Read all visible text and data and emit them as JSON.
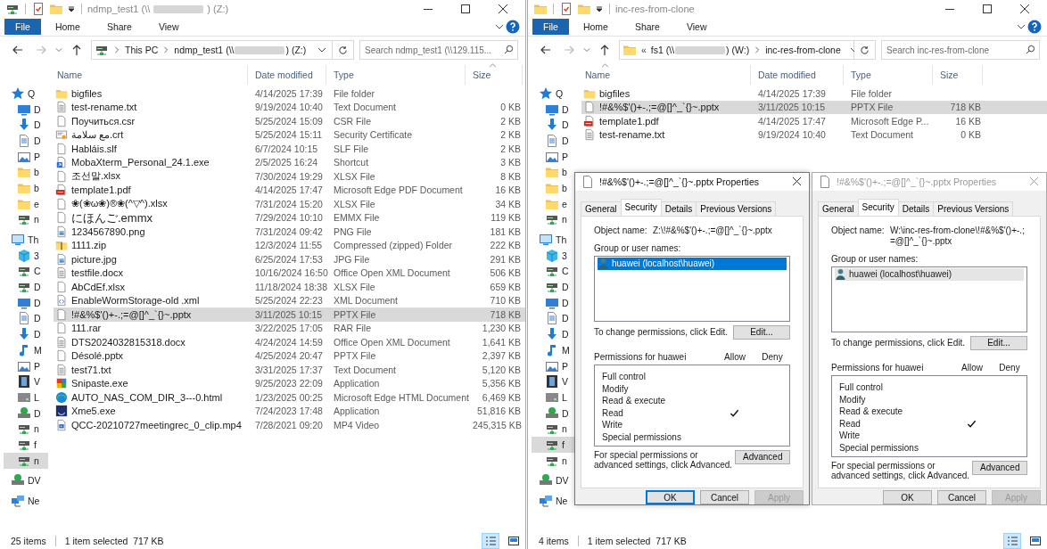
{
  "windows": [
    {
      "title": [
        "ndmp_test1 (\\\\",
        ") (Z:)"
      ],
      "ribbon_tabs": [
        {
          "label": "File",
          "kind": "file"
        },
        {
          "label": "Home",
          "kind": "tab"
        },
        {
          "label": "Share",
          "kind": "tab"
        },
        {
          "label": "View",
          "kind": "tab"
        }
      ],
      "address": {
        "crumbs": [
          [
            "This PC"
          ],
          [
            "ndmp_test1 (\\\\",
            ") (Z:)"
          ]
        ]
      },
      "search_placeholder": "Search ndmp_test1 (\\\\129.115...",
      "columns": [
        {
          "label": "Name",
          "sorted": false
        },
        {
          "label": "Date modified",
          "sorted": false
        },
        {
          "label": "Type",
          "sorted": false
        },
        {
          "label": "Size",
          "sorted": true
        }
      ],
      "nav": [
        {
          "kind": "quick-access",
          "label": "Q",
          "selected": false
        },
        {
          "kind": "desktop",
          "label": "D",
          "selected": false
        },
        {
          "kind": "download",
          "label": "D",
          "selected": false
        },
        {
          "kind": "doc",
          "label": "D",
          "selected": false
        },
        {
          "kind": "picture",
          "label": "P",
          "selected": false
        },
        {
          "kind": "folder",
          "label": "b",
          "selected": false
        },
        {
          "kind": "folder",
          "label": "b",
          "selected": false
        },
        {
          "kind": "folder",
          "label": "e",
          "selected": false
        },
        {
          "kind": "netdrive",
          "label": "n",
          "selected": false
        },
        {
          "kind": "this-pc",
          "label": "Th",
          "selected": false
        },
        {
          "kind": "cube",
          "label": "3",
          "selected": false
        },
        {
          "kind": "netdrive",
          "label": "C",
          "selected": false
        },
        {
          "kind": "netdrive",
          "label": "D",
          "selected": false
        },
        {
          "kind": "desktop",
          "label": "D",
          "selected": false
        },
        {
          "kind": "doc",
          "label": "D",
          "selected": false
        },
        {
          "kind": "download",
          "label": "D",
          "selected": false
        },
        {
          "kind": "music",
          "label": "M",
          "selected": false
        },
        {
          "kind": "picture",
          "label": "P",
          "selected": false
        },
        {
          "kind": "film",
          "label": "V",
          "selected": false
        },
        {
          "kind": "disk",
          "label": "L",
          "selected": false
        },
        {
          "kind": "dvd",
          "label": "D",
          "selected": false
        },
        {
          "kind": "netdrive",
          "label": "n",
          "selected": false
        },
        {
          "kind": "netdrive",
          "label": "f",
          "selected": false
        },
        {
          "kind": "netdrive",
          "label": "n",
          "selected": true
        },
        {
          "kind": "dvd-root",
          "label": "DV",
          "selected": false
        },
        {
          "kind": "network",
          "label": "Ne",
          "selected": false
        }
      ],
      "files": [
        {
          "kind": "folder",
          "name": "bigfiles",
          "date": "4/14/2025 17:39",
          "type": "File folder",
          "selected": false
        },
        {
          "kind": "text",
          "name": "test-rename.txt",
          "date": "9/19/2024 10:40",
          "type": "Text Document",
          "size": "0 KB",
          "selected": false
        },
        {
          "kind": "blank",
          "name": "Поучиться.csr",
          "date": "5/25/2024 15:09",
          "type": "CSR File",
          "size": "2 KB",
          "selected": false
        },
        {
          "kind": "cert",
          "name": "مع سلامة.crt",
          "date": "5/25/2024 15:11",
          "type": "Security Certificate",
          "size": "2 KB",
          "selected": false
        },
        {
          "kind": "blank",
          "name": "Habláis.slf",
          "date": "6/7/2024 10:15",
          "type": "SLF File",
          "size": "2 KB",
          "selected": false
        },
        {
          "kind": "shortcut",
          "name": "MobaXterm_Personal_24.1.exe",
          "date": "2/5/2025 16:24",
          "type": "Shortcut",
          "size": "3 KB",
          "selected": false
        },
        {
          "kind": "blank",
          "name": "조선말.xlsx",
          "date": "7/30/2024 19:29",
          "type": "XLSX File",
          "size": "8 KB",
          "selected": false
        },
        {
          "kind": "pdf",
          "name": "template1.pdf",
          "date": "4/14/2025 17:47",
          "type": "Microsoft Edge PDF Document",
          "size": "16 KB",
          "selected": false
        },
        {
          "kind": "blank",
          "name": "❀(❀ω❀)®❀(^▽^).xlsx",
          "date": "7/31/2024 15:20",
          "type": "XLSX File",
          "size": "34 KB",
          "selected": false
        },
        {
          "kind": "blank",
          "name": "にほんご.emmx",
          "date": "7/29/2024 10:10",
          "type": "EMMX File",
          "size": "119 KB",
          "selected": false
        },
        {
          "kind": "image",
          "name": "1234567890.png",
          "date": "7/31/2024 09:42",
          "type": "PNG File",
          "size": "181 KB",
          "selected": false
        },
        {
          "kind": "zip",
          "name": "1111.zip",
          "date": "12/3/2024 11:55",
          "type": "Compressed (zipped) Folder",
          "size": "222 KB",
          "selected": false
        },
        {
          "kind": "image",
          "name": "picture.jpg",
          "date": "6/25/2024 17:53",
          "type": "JPG File",
          "size": "291 KB",
          "selected": false
        },
        {
          "kind": "text",
          "name": "testfile.docx",
          "date": "10/16/2024 16:50",
          "type": "Office Open XML Document",
          "size": "506 KB",
          "selected": false
        },
        {
          "kind": "blank",
          "name": "AbCdEf.xlsx",
          "date": "11/18/2024 18:38",
          "type": "XLSX File",
          "size": "659 KB",
          "selected": false
        },
        {
          "kind": "xml",
          "name": "EnableWormStorage-old .xml",
          "date": "5/25/2024 22:23",
          "type": "XML Document",
          "size": "710 KB",
          "selected": false
        },
        {
          "kind": "blank",
          "name": "!#&%$'()+-.;=@[]^_`{}~.pptx",
          "date": "3/11/2025 10:15",
          "type": "PPTX File",
          "size": "718 KB",
          "selected": true
        },
        {
          "kind": "blank",
          "name": "111.rar",
          "date": "3/22/2025 17:05",
          "type": "RAR File",
          "size": "1,230 KB",
          "selected": false
        },
        {
          "kind": "text",
          "name": "DTS2024032815318.docx",
          "date": "4/24/2024 14:59",
          "type": "Office Open XML Document",
          "size": "1,641 KB",
          "selected": false
        },
        {
          "kind": "blank",
          "name": "Désolé.pptx",
          "date": "4/25/2024 20:47",
          "type": "PPTX File",
          "size": "2,397 KB",
          "selected": false
        },
        {
          "kind": "text",
          "name": "test71.txt",
          "date": "3/31/2025 17:37",
          "type": "Text Document",
          "size": "5,120 KB",
          "selected": false
        },
        {
          "kind": "app",
          "name": "Snipaste.exe",
          "date": "9/25/2023 22:09",
          "type": "Application",
          "size": "5,356 KB",
          "selected": false
        },
        {
          "kind": "edge",
          "name": "AUTO_NAS_COM_DIR_3---0.html",
          "date": "1/23/2025 00:25",
          "type": "Microsoft Edge HTML Document",
          "size": "6,469 KB",
          "selected": false
        },
        {
          "kind": "xme",
          "name": "Xme5.exe",
          "date": "7/24/2023 17:48",
          "type": "Application",
          "size": "51,816 KB",
          "selected": false
        },
        {
          "kind": "video",
          "name": "QCC-20210727meetingrec_0_clip.mp4",
          "date": "7/28/2021 09:20",
          "type": "MP4 Video",
          "size": "245,315 KB",
          "selected": false
        }
      ],
      "status": {
        "count": "25 items",
        "selection": "1 item selected  717 KB"
      },
      "views": [
        {
          "kind": "details",
          "selected": true
        },
        {
          "kind": "large",
          "selected": false
        }
      ]
    },
    {
      "title": [
        "inc-res-from-clone"
      ],
      "ribbon_tabs": [
        {
          "label": "File",
          "kind": "file"
        },
        {
          "label": "Home",
          "kind": "tab"
        },
        {
          "label": "Share",
          "kind": "tab"
        },
        {
          "label": "View",
          "kind": "tab"
        }
      ],
      "address": {
        "lead": "«",
        "crumbs": [
          [
            "fs1 (\\\\",
            ") (W:)"
          ],
          [
            "inc-res-from-clone"
          ]
        ]
      },
      "search_placeholder": "Search inc-res-from-clone",
      "columns": [
        {
          "label": "Name",
          "sorted": true
        },
        {
          "label": "Date modified",
          "sorted": false
        },
        {
          "label": "Type",
          "sorted": false
        },
        {
          "label": "Size",
          "sorted": false
        }
      ],
      "nav": [
        {
          "kind": "quick-access",
          "label": "Q",
          "selected": false
        },
        {
          "kind": "desktop",
          "label": "D",
          "selected": false
        },
        {
          "kind": "download",
          "label": "D",
          "selected": false
        },
        {
          "kind": "doc",
          "label": "D",
          "selected": false
        },
        {
          "kind": "picture",
          "label": "P",
          "selected": false
        },
        {
          "kind": "folder",
          "label": "b",
          "selected": false
        },
        {
          "kind": "folder",
          "label": "b",
          "selected": false
        },
        {
          "kind": "folder",
          "label": "e",
          "selected": false
        },
        {
          "kind": "netdrive",
          "label": "n",
          "selected": false
        },
        {
          "kind": "this-pc",
          "label": "Th",
          "selected": false
        },
        {
          "kind": "cube",
          "label": "3",
          "selected": false
        },
        {
          "kind": "netdrive",
          "label": "C",
          "selected": false
        },
        {
          "kind": "netdrive",
          "label": "D",
          "selected": false
        },
        {
          "kind": "desktop",
          "label": "D",
          "selected": false
        },
        {
          "kind": "doc",
          "label": "D",
          "selected": false
        },
        {
          "kind": "download",
          "label": "D",
          "selected": false
        },
        {
          "kind": "music",
          "label": "M",
          "selected": false
        },
        {
          "kind": "picture",
          "label": "P",
          "selected": false
        },
        {
          "kind": "film",
          "label": "V",
          "selected": false
        },
        {
          "kind": "disk",
          "label": "L",
          "selected": false
        },
        {
          "kind": "dvd",
          "label": "D",
          "selected": false
        },
        {
          "kind": "netdrive",
          "label": "n",
          "selected": false
        },
        {
          "kind": "netdrive",
          "label": "f",
          "selected": true
        },
        {
          "kind": "netdrive",
          "label": "n",
          "selected": false
        },
        {
          "kind": "dvd-root",
          "label": "DV",
          "selected": false
        },
        {
          "kind": "network",
          "label": "Ne",
          "selected": false
        }
      ],
      "files": [
        {
          "kind": "folder",
          "name": "bigfiles",
          "date": "4/14/2025 17:39",
          "type": "File folder",
          "selected": false
        },
        {
          "kind": "blank",
          "name": "!#&%$'()+-.;=@[]^_`{}~.pptx",
          "date": "3/11/2025 10:15",
          "type": "PPTX File",
          "size": "718 KB",
          "selected": true
        },
        {
          "kind": "pdf",
          "name": "template1.pdf",
          "date": "4/14/2025 17:47",
          "type": "Microsoft Edge P...",
          "size": "16 KB",
          "selected": false
        },
        {
          "kind": "text",
          "name": "test-rename.txt",
          "date": "9/19/2024 10:40",
          "type": "Text Document",
          "size": "0 KB",
          "selected": false
        }
      ],
      "status": {
        "count": "4 items",
        "selection": "1 item selected  717 KB"
      },
      "views": [
        {
          "kind": "details",
          "selected": true
        },
        {
          "kind": "large",
          "selected": false
        }
      ],
      "dialogs": [
        {
          "title": "!#&%$'()+-.;=@[]^_`{}~.pptx Properties",
          "active": true,
          "tabs": [
            {
              "label": "General",
              "selected": false
            },
            {
              "label": "Security",
              "selected": true
            },
            {
              "label": "Details",
              "selected": false
            },
            {
              "label": "Previous Versions",
              "selected": false
            }
          ],
          "object_label": "Object name:",
          "object_name": "Z:\\!#&%$'()+-.;=@[]^_`{}~.pptx",
          "group_label": "Group or user names:",
          "users": [
            {
              "name": "huawei (localhost\\huawei)",
              "selected": true
            }
          ],
          "change_hint": "To change permissions, click Edit.",
          "edit_button": "Edit...",
          "perms_label": "Permissions for huawei",
          "allow_label": "Allow",
          "deny_label": "Deny",
          "permissions": [
            {
              "name": "Full control",
              "allow": false,
              "deny": false
            },
            {
              "name": "Modify",
              "allow": false,
              "deny": false
            },
            {
              "name": "Read & execute",
              "allow": false,
              "deny": false
            },
            {
              "name": "Read",
              "allow": true,
              "deny": false
            },
            {
              "name": "Write",
              "allow": false,
              "deny": false
            },
            {
              "name": "Special permissions",
              "allow": false,
              "deny": false
            }
          ],
          "advanced_hint": "For special permissions or advanced settings, click Advanced.",
          "advanced_button": "Advanced",
          "buttons": [
            {
              "label": "OK",
              "kind": "ok",
              "disabled": false
            },
            {
              "label": "Cancel",
              "kind": "cancel",
              "disabled": false
            },
            {
              "label": "Apply",
              "kind": "apply",
              "disabled": true
            }
          ]
        },
        {
          "title": "!#&%$'()+-.;=@[]^_`{}~.pptx Properties",
          "active": false,
          "tabs": [
            {
              "label": "General",
              "selected": false
            },
            {
              "label": "Security",
              "selected": true
            },
            {
              "label": "Details",
              "selected": false
            },
            {
              "label": "Previous Versions",
              "selected": false
            }
          ],
          "object_label": "Object name:",
          "object_name": "W:\\inc-res-from-clone\\!#&%$'()+-.;=@[]^_`{}~.pptx",
          "group_label": "Group or user names:",
          "users": [
            {
              "name": "huawei (localhost\\huawei)",
              "selected": true
            }
          ],
          "change_hint": "To change permissions, click Edit.",
          "edit_button": "Edit...",
          "perms_label": "Permissions for huawei",
          "allow_label": "Allow",
          "deny_label": "Deny",
          "permissions": [
            {
              "name": "Full control",
              "allow": false,
              "deny": false
            },
            {
              "name": "Modify",
              "allow": false,
              "deny": false
            },
            {
              "name": "Read & execute",
              "allow": false,
              "deny": false
            },
            {
              "name": "Read",
              "allow": true,
              "deny": false
            },
            {
              "name": "Write",
              "allow": false,
              "deny": false
            },
            {
              "name": "Special permissions",
              "allow": false,
              "deny": false
            }
          ],
          "advanced_hint": "For special permissions or advanced settings, click Advanced.",
          "advanced_button": "Advanced",
          "buttons": [
            {
              "label": "OK",
              "kind": "ok",
              "disabled": false
            },
            {
              "label": "Cancel",
              "kind": "cancel",
              "disabled": false
            },
            {
              "label": "Apply",
              "kind": "apply",
              "disabled": true
            }
          ]
        }
      ]
    }
  ]
}
